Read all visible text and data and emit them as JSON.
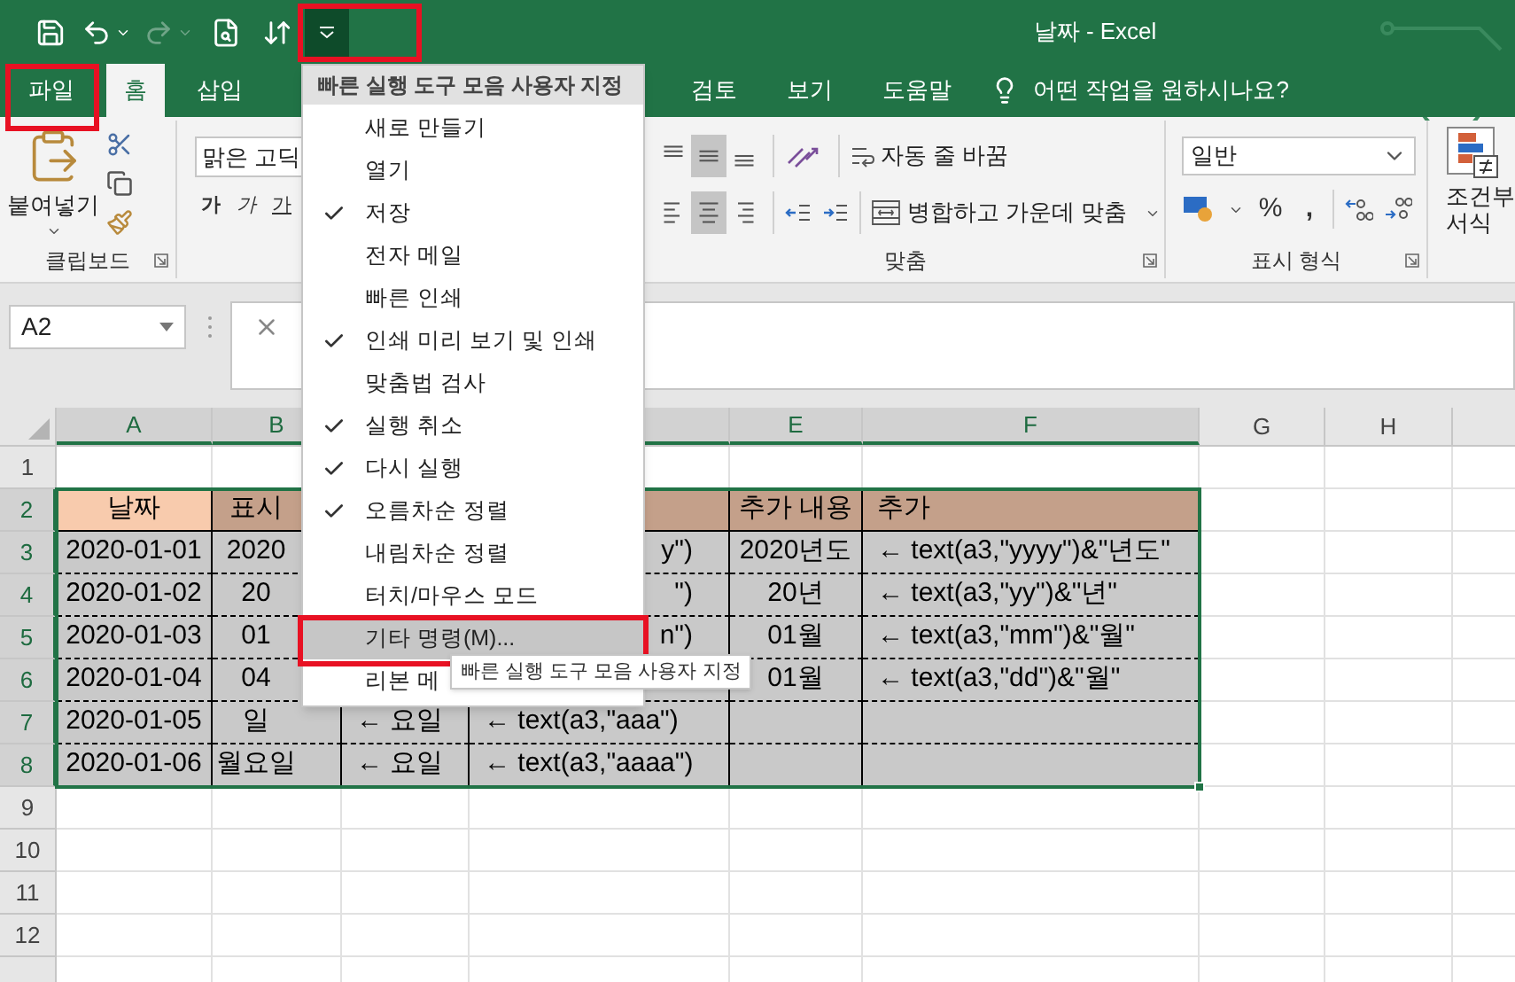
{
  "title_bar": {
    "title": "날짜 - Excel",
    "quick_access": [
      {
        "kind": "save",
        "disabled": false
      },
      {
        "kind": "undo",
        "disabled": false
      },
      {
        "kind": "redo",
        "disabled": true
      },
      {
        "kind": "print_preview",
        "disabled": false
      },
      {
        "kind": "sort",
        "disabled": false
      }
    ],
    "customize_button": {
      "pressed": true,
      "marked": true
    }
  },
  "ribbon_tabs": [
    {
      "label": "파일",
      "selected": false,
      "marked": true
    },
    {
      "label": "홈",
      "selected": true,
      "marked": false
    },
    {
      "label": "삽입",
      "selected": false,
      "marked": false
    },
    {
      "label": "검토",
      "selected": false,
      "marked": false
    },
    {
      "label": "보기",
      "selected": false,
      "marked": false
    },
    {
      "label": "도움말",
      "selected": false,
      "marked": false
    }
  ],
  "tell_me": {
    "label": "어떤 작업을 원하시나요?"
  },
  "ribbon": {
    "clipboard": {
      "paste": "붙여넣기",
      "label": "클립보드"
    },
    "font": {
      "font_name": "맑은 고딕",
      "styles": [
        {
          "kind": "bold",
          "label": "가"
        },
        {
          "kind": "italic",
          "label": "가"
        },
        {
          "kind": "underline",
          "label": "가"
        }
      ]
    },
    "alignment": {
      "vertical": [
        {
          "kind": "top",
          "selected": false
        },
        {
          "kind": "middle",
          "selected": true
        },
        {
          "kind": "bottom",
          "selected": false
        }
      ],
      "horizontal": [
        {
          "kind": "left",
          "selected": false
        },
        {
          "kind": "center",
          "selected": true
        },
        {
          "kind": "right",
          "selected": false
        }
      ],
      "wrap_text": "자동 줄 바꿈",
      "merge_center": "병합하고 가운데 맞춤",
      "label": "맞춤"
    },
    "number": {
      "format": "일반",
      "percent": "%",
      "comma": ",",
      "label": "표시 형식"
    },
    "styles": {
      "label": "조건부 서식"
    }
  },
  "formula_bar": {
    "name_box": "A2"
  },
  "sheet": {
    "columns": [
      {
        "label": "A",
        "selected": true
      },
      {
        "label": "B",
        "selected": true
      },
      {},
      {
        "selected": true
      },
      {
        "label": "E",
        "selected": true
      },
      {
        "label": "F",
        "selected": true
      },
      {
        "label": "G",
        "selected": false
      },
      {
        "label": "H",
        "selected": false
      }
    ],
    "rows": [
      {
        "label": "1",
        "selected": false,
        "kind": "plain"
      },
      {
        "label": "2",
        "selected": true,
        "kind": "header",
        "cells": {
          "A": "날짜",
          "B": "표시",
          "E": "추가 내용",
          "F": "추가"
        }
      },
      {
        "label": "3",
        "selected": true,
        "kind": "data",
        "cells": {
          "A": "2020-01-01",
          "B": "2020",
          "D": "y\")",
          "E": "2020년도",
          "F": "← text(a3,\"yyyy\")&\"년도\""
        }
      },
      {
        "label": "4",
        "selected": true,
        "kind": "data",
        "cells": {
          "A": "2020-01-02",
          "B": "20",
          "D": "\")",
          "E": "20년",
          "F": "← text(a3,\"yy\")&\"년\""
        }
      },
      {
        "label": "5",
        "selected": true,
        "kind": "data",
        "cells": {
          "A": "2020-01-03",
          "B": "01",
          "D": "n\")",
          "E": "01월",
          "F": "← text(a3,\"mm\")&\"월\""
        }
      },
      {
        "label": "6",
        "selected": true,
        "kind": "data",
        "cells": {
          "A": "2020-01-04",
          "B": "04",
          "E": "01월",
          "F": "← text(a3,\"dd\")&\"월\""
        }
      },
      {
        "label": "7",
        "selected": true,
        "kind": "data",
        "cells": {
          "A": "2020-01-05",
          "B": "일",
          "C": "← 요일",
          "D": "← text(a3,\"aaa\")"
        }
      },
      {
        "label": "8",
        "selected": true,
        "kind": "data",
        "cells": {
          "A": "2020-01-06",
          "B": "월요일",
          "C": "← 요일",
          "D": "← text(a3,\"aaaa\")"
        }
      },
      {
        "label": "9",
        "selected": false,
        "kind": "plain"
      },
      {
        "label": "10",
        "selected": false,
        "kind": "plain"
      },
      {
        "label": "11",
        "selected": false,
        "kind": "plain"
      },
      {
        "label": "12",
        "selected": false,
        "kind": "plain"
      }
    ]
  },
  "quick_access_menu": {
    "title": "빠른 실행 도구 모음 사용자 지정",
    "items": [
      {
        "label": "새로 만들기",
        "checked": false,
        "selected": false,
        "marked": false
      },
      {
        "label": "열기",
        "checked": false,
        "selected": false,
        "marked": false
      },
      {
        "label": "저장",
        "checked": true,
        "selected": false,
        "marked": false
      },
      {
        "label": "전자 메일",
        "checked": false,
        "selected": false,
        "marked": false
      },
      {
        "label": "빠른 인쇄",
        "checked": false,
        "selected": false,
        "marked": false
      },
      {
        "label": "인쇄 미리 보기 및 인쇄",
        "checked": true,
        "selected": false,
        "marked": false
      },
      {
        "label": "맞춤법 검사",
        "checked": false,
        "selected": false,
        "marked": false
      },
      {
        "label": "실행 취소",
        "checked": true,
        "selected": false,
        "marked": false
      },
      {
        "label": "다시 실행",
        "checked": true,
        "selected": false,
        "marked": false
      },
      {
        "label": "오름차순 정렬",
        "checked": true,
        "selected": false,
        "marked": false
      },
      {
        "label": "내림차순 정렬",
        "checked": false,
        "selected": false,
        "marked": false
      },
      {
        "label": "터치/마우스 모드",
        "checked": false,
        "selected": false,
        "marked": false
      },
      {
        "label": "기타 명령(M)...",
        "checked": false,
        "selected": true,
        "marked": true
      },
      {
        "label": "리본 메",
        "checked": false,
        "selected": false,
        "marked": false
      }
    ]
  },
  "tooltip": {
    "text": "빠른 실행 도구 모음 사용자 지정"
  }
}
